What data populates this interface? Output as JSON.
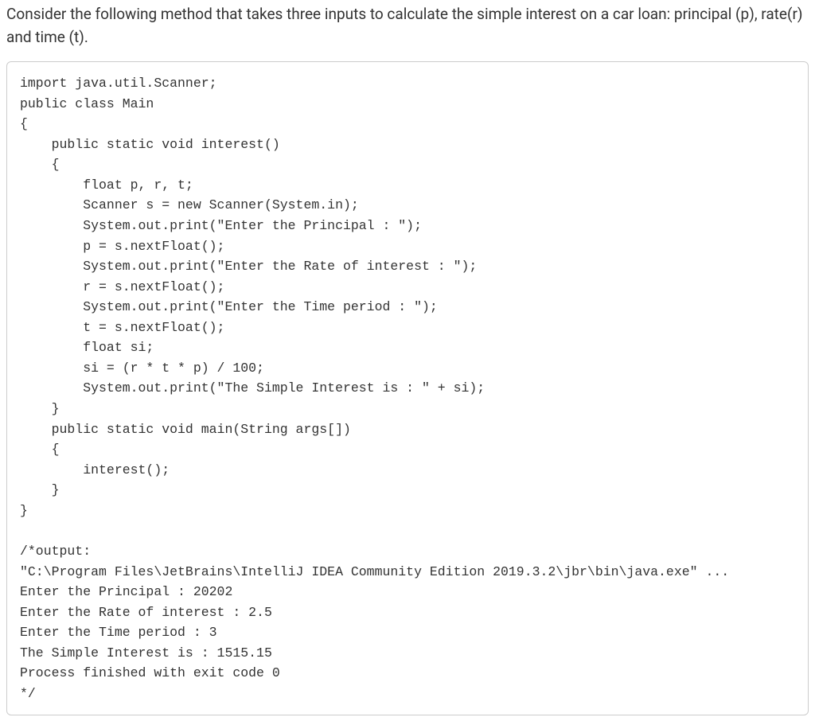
{
  "question": "Consider the following method that takes three inputs to calculate the simple interest on a car loan: principal (p), rate(r) and time (t).",
  "code": "import java.util.Scanner;\npublic class Main\n{\n    public static void interest()\n    {\n        float p, r, t;\n        Scanner s = new Scanner(System.in);\n        System.out.print(\"Enter the Principal : \");\n        p = s.nextFloat();\n        System.out.print(\"Enter the Rate of interest : \");\n        r = s.nextFloat();\n        System.out.print(\"Enter the Time period : \");\n        t = s.nextFloat();\n        float si;\n        si = (r * t * p) / 100;\n        System.out.print(\"The Simple Interest is : \" + si);\n    }\n    public static void main(String args[])\n    {\n        interest();\n    }\n}\n\n/*output:\n\"C:\\Program Files\\JetBrains\\IntelliJ IDEA Community Edition 2019.3.2\\jbr\\bin\\java.exe\" ...\nEnter the Principal : 20202\nEnter the Rate of interest : 2.5\nEnter the Time period : 3\nThe Simple Interest is : 1515.15\nProcess finished with exit code 0\n*/"
}
